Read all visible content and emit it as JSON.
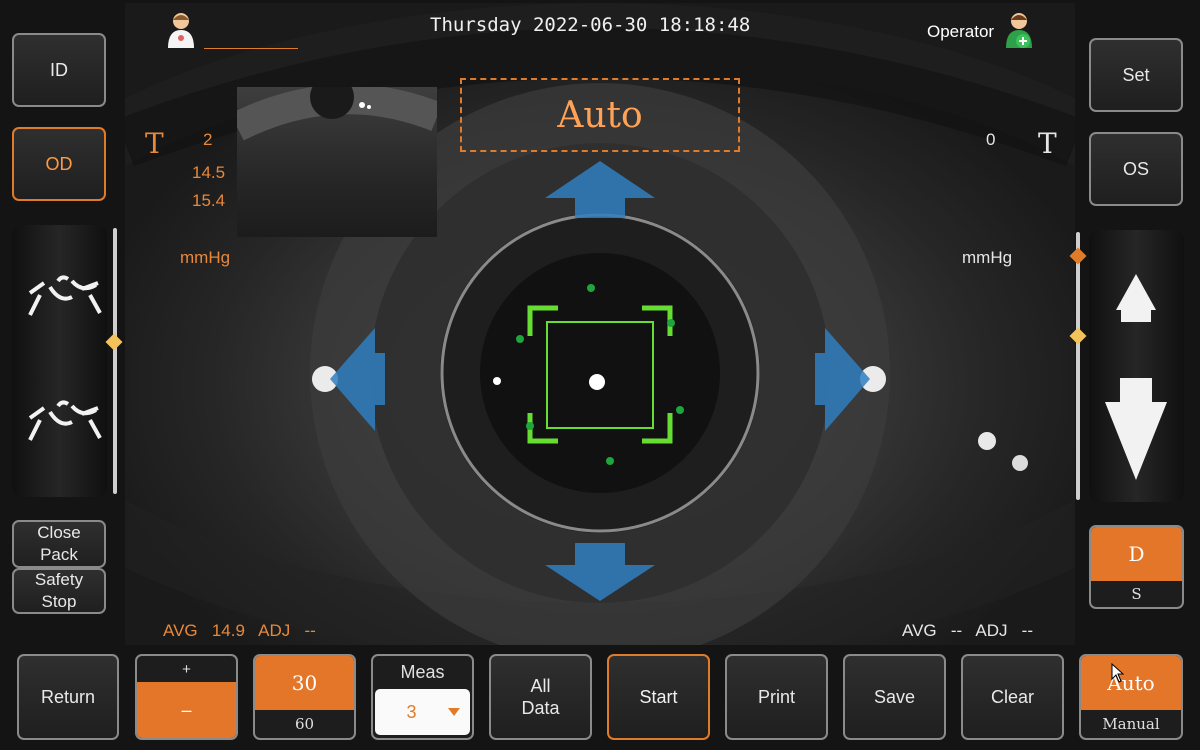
{
  "header": {
    "datetime": "Thursday 2022-06-30 18:18:48",
    "operator_label": "Operator"
  },
  "left_panel": {
    "id_label": "ID",
    "od_label": "OD",
    "close_pack_label": "Close\nPack",
    "safety_stop_label": "Safety\nStop"
  },
  "right_panel": {
    "set_label": "Set",
    "os_label": "OS",
    "d_label": "D",
    "s_label": "S"
  },
  "viewport": {
    "mode_label": "Auto",
    "left": {
      "t_label": "T",
      "readings": [
        "2",
        "14.5",
        "15.4"
      ],
      "unit": "mmHg",
      "avg_label": "AVG",
      "avg_value": "14.9",
      "adj_label": "ADJ",
      "adj_value": "--"
    },
    "right": {
      "t_label": "T",
      "reading": "0",
      "unit": "mmHg",
      "avg_label": "AVG",
      "avg_value": "--",
      "adj_label": "ADJ",
      "adj_value": "--"
    }
  },
  "bottom_bar": {
    "return_label": "Return",
    "plus_label": "+",
    "minus_label": "–",
    "pressure_high": "30",
    "pressure_low": "60",
    "meas_label": "Meas",
    "meas_value": "3",
    "all_data_label": "All\nData",
    "start_label": "Start",
    "print_label": "Print",
    "save_label": "Save",
    "clear_label": "Clear",
    "auto_label": "Auto",
    "manual_label": "Manual"
  },
  "colors": {
    "accent": "#e4762a",
    "target_green": "#66dd33",
    "arrow_blue": "#2f7fbf"
  }
}
